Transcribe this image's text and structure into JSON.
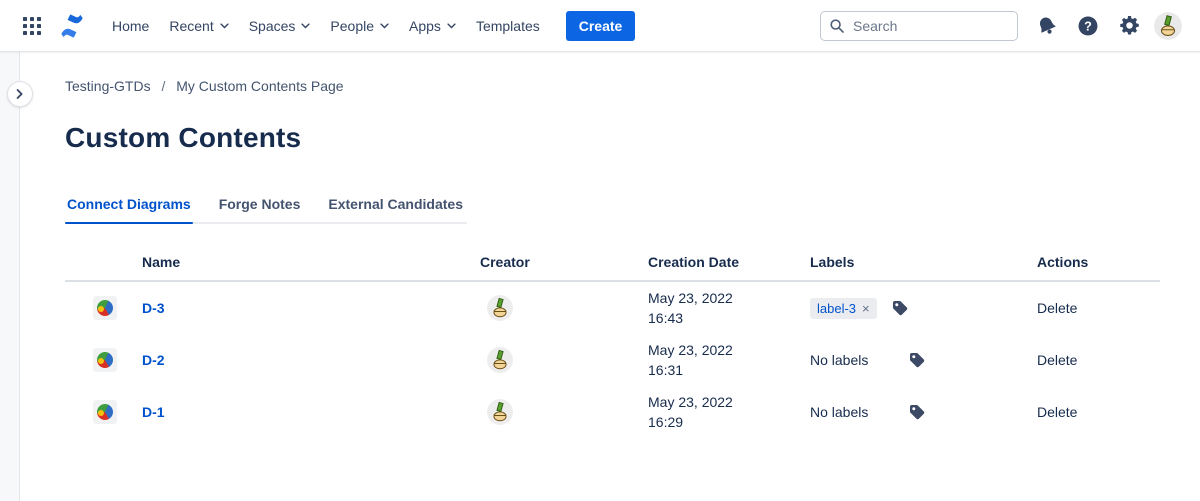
{
  "nav": {
    "items": [
      {
        "label": "Home",
        "has_dropdown": false
      },
      {
        "label": "Recent",
        "has_dropdown": true
      },
      {
        "label": "Spaces",
        "has_dropdown": true
      },
      {
        "label": "People",
        "has_dropdown": true
      },
      {
        "label": "Apps",
        "has_dropdown": true
      },
      {
        "label": "Templates",
        "has_dropdown": false
      }
    ],
    "create_label": "Create",
    "search_placeholder": "Search"
  },
  "breadcrumb": {
    "space": "Testing-GTDs",
    "separator": "/",
    "page": "My Custom Contents Page"
  },
  "page": {
    "title": "Custom Contents"
  },
  "tabs": [
    {
      "label": "Connect Diagrams",
      "active": true
    },
    {
      "label": "Forge Notes",
      "active": false
    },
    {
      "label": "External Candidates",
      "active": false
    }
  ],
  "table": {
    "headers": [
      "Name",
      "Creator",
      "Creation Date",
      "Labels",
      "Actions"
    ],
    "rows": [
      {
        "name": "D-3",
        "date_line1": "May 23, 2022",
        "date_line2": "16:43",
        "label_chip": "label-3",
        "chip_remove": "×",
        "no_labels": "",
        "action": "Delete"
      },
      {
        "name": "D-2",
        "date_line1": "May 23, 2022",
        "date_line2": "16:31",
        "label_chip": "",
        "no_labels": "No labels",
        "action": "Delete"
      },
      {
        "name": "D-1",
        "date_line1": "May 23, 2022",
        "date_line2": "16:29",
        "label_chip": "",
        "no_labels": "No labels",
        "action": "Delete"
      }
    ]
  },
  "icons": {
    "app_switcher": "grid-3x3",
    "logo": "confluence-mark",
    "search": "magnifier",
    "notifications": "bell",
    "help": "question-circle",
    "settings": "gear",
    "sidebar_expand": "chevron-right",
    "content_type": "pie-diagram",
    "add_label": "tag"
  },
  "colors": {
    "brand_blue": "#0C66E4",
    "link_blue": "#0052CC",
    "heading": "#172B4D",
    "nav_text": "#344563",
    "chip_bg": "#EBECF0",
    "rail_bg": "#F7F8F9",
    "divider": "#DCDFE4"
  }
}
